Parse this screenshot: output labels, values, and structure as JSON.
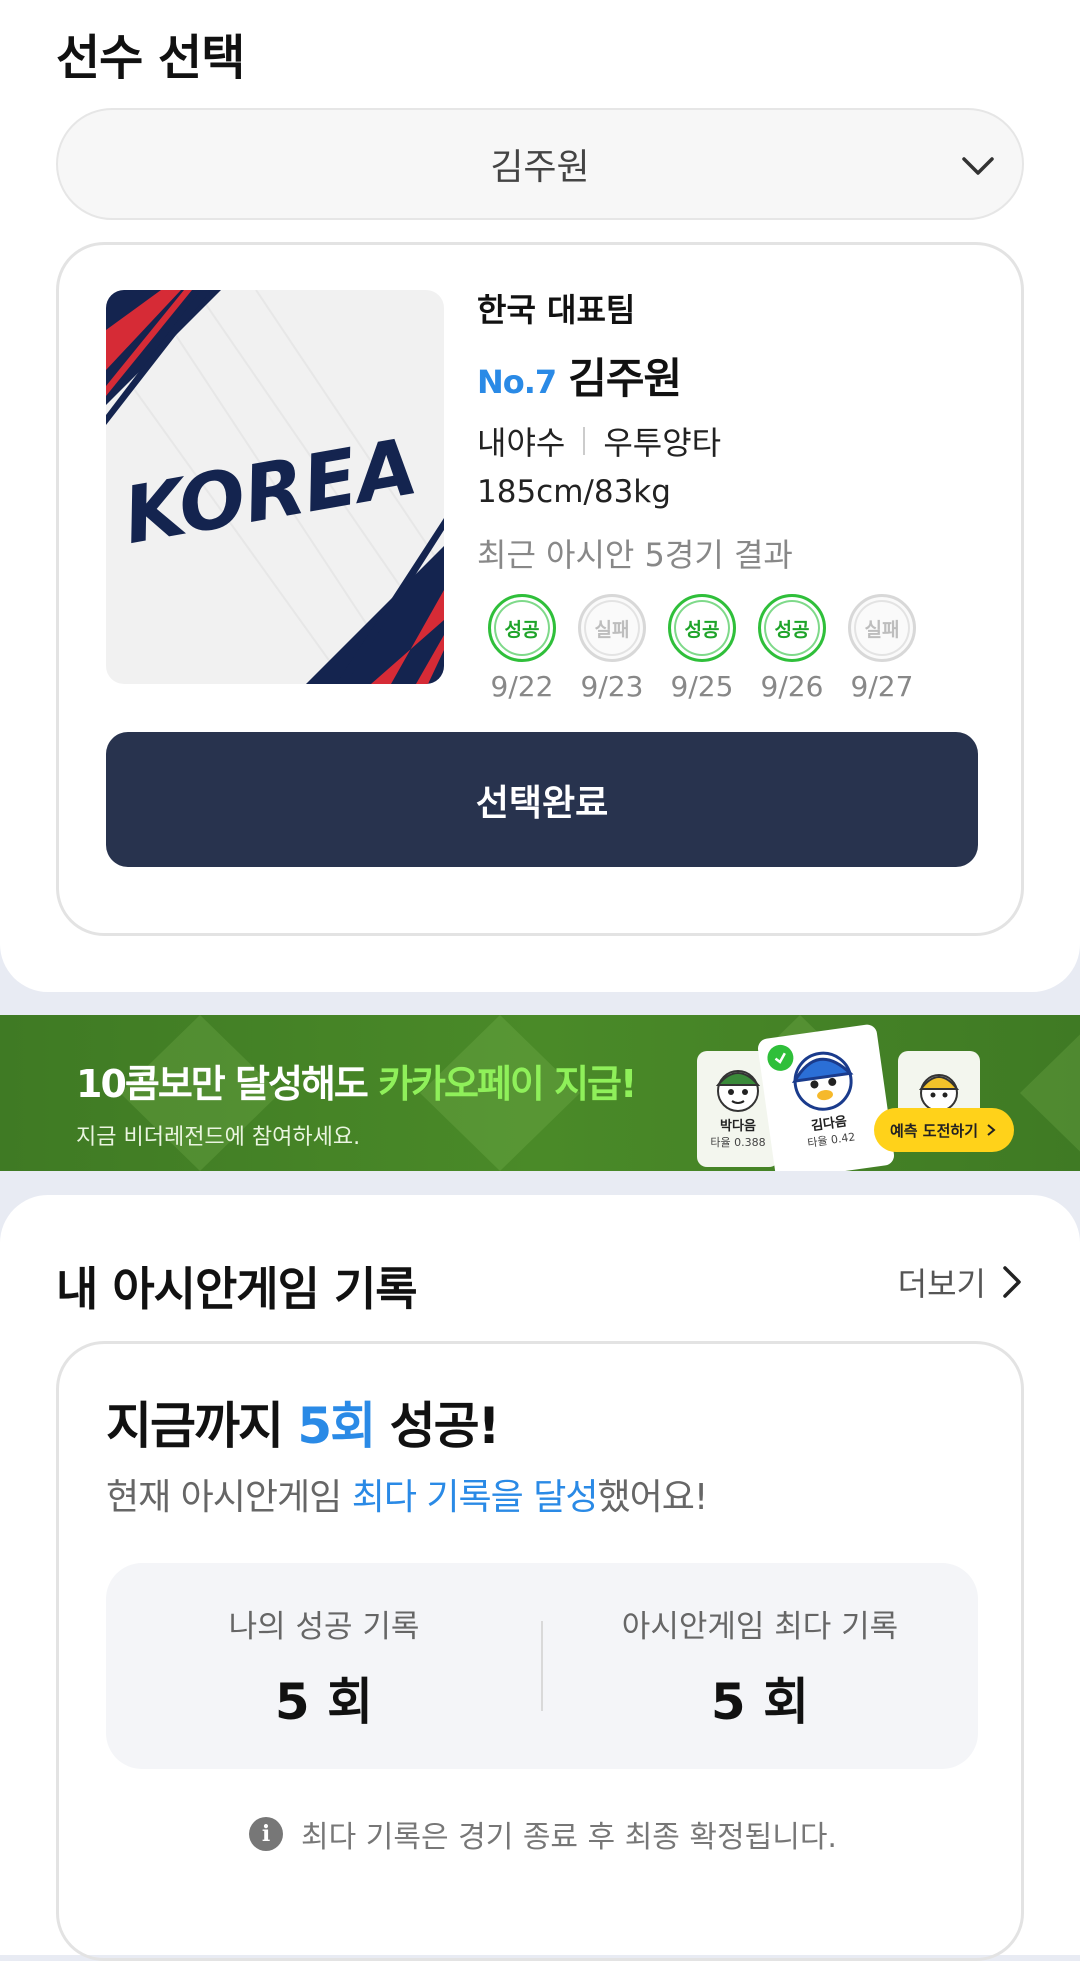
{
  "select_section": {
    "title": "선수 선택",
    "selected_player": "김주원"
  },
  "player": {
    "team": "한국 대표팀",
    "number": "No.7",
    "name": "김주원",
    "position": "내야수",
    "batting": "우투양타",
    "body": "185cm/83kg",
    "logo_text": "KOREA",
    "recent_title": "최근 아시안 5경기 결과",
    "results": [
      {
        "status": "성공",
        "type": "success",
        "date": "9/22"
      },
      {
        "status": "실패",
        "type": "fail",
        "date": "9/23"
      },
      {
        "status": "성공",
        "type": "success",
        "date": "9/25"
      },
      {
        "status": "성공",
        "type": "success",
        "date": "9/26"
      },
      {
        "status": "실패",
        "type": "fail",
        "date": "9/27"
      }
    ],
    "confirm_label": "선택완료"
  },
  "banner": {
    "headline_part1": "10콤보만 달성해도 ",
    "headline_part2": "카카오페이 지급!",
    "subtitle": "지금 비더레전드에 참여하세요.",
    "card1_name": "박다음",
    "card1_avg": "타율 0.388",
    "card2_name": "김다음",
    "card2_avg": "타율 0.42",
    "button_label": "예측 도전하기"
  },
  "record": {
    "title": "내 아시안게임 기록",
    "more_label": "더보기",
    "headline_prefix": "지금까지 ",
    "headline_count": "5회",
    "headline_suffix": " 성공!",
    "sub_prefix": "현재 아시안게임 ",
    "sub_highlight": "최다 기록을 달성",
    "sub_suffix": "했어요!",
    "my_label": "나의 성공 기록",
    "my_value": "5 회",
    "max_label": "아시안게임 최다 기록",
    "max_value": "5 회",
    "notice": "최다 기록은 경기 종료 후 최종 확정됩니다."
  },
  "colors": {
    "accent_blue": "#2a8ae6",
    "button_navy": "#28334e",
    "success_green": "#2fbf3a",
    "banner_green": "#4a8a28",
    "banner_highlight": "#8ff05a",
    "predict_yellow": "#ffd21a"
  },
  "icons": [
    "chevron-down-icon",
    "chevron-right-icon",
    "info-icon",
    "check-icon"
  ]
}
